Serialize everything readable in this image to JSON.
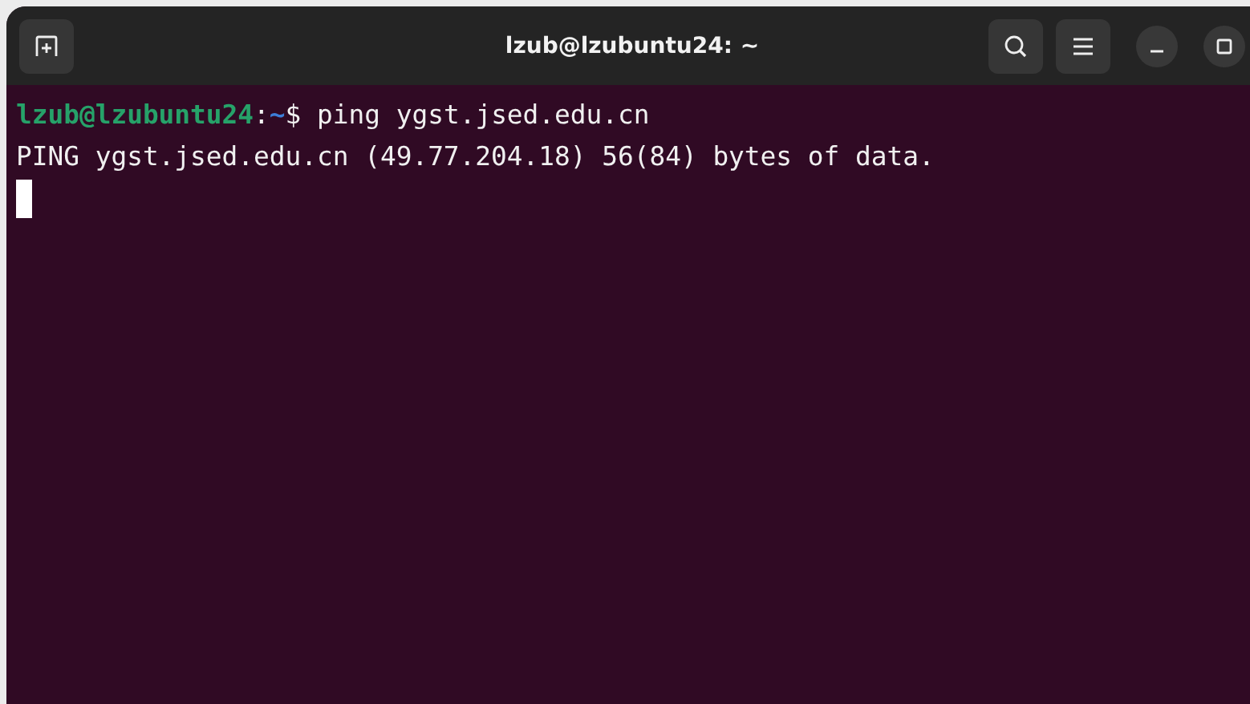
{
  "window": {
    "title": "lzub@lzubuntu24: ~"
  },
  "lines": [
    {
      "kind": "prompt",
      "user_host": "lzub@lzubuntu24",
      "separator": ":",
      "path": "~",
      "command": "$ ping ygst.jsed.edu.cn"
    },
    {
      "kind": "output",
      "text": "PING ygst.jsed.edu.cn (49.77.204.18) 56(84) bytes of data."
    }
  ]
}
